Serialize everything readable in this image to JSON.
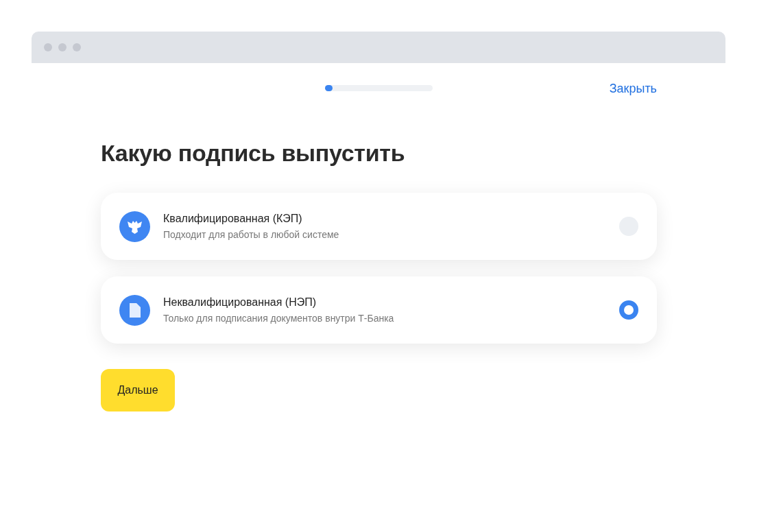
{
  "progress": {
    "level": 0.07
  },
  "close_link": "Закрыть",
  "title": "Какую подпись выпустить",
  "options": [
    {
      "kind": "emblem",
      "title": "Квалифицированная (КЭП)",
      "subtitle": "Подходит для работы в любой системе",
      "selected": false
    },
    {
      "kind": "document",
      "title": "Неквалифицированная (НЭП)",
      "subtitle": "Только для подписания документов внутри Т-Банка",
      "selected": true
    }
  ],
  "next_button": "Дальше"
}
